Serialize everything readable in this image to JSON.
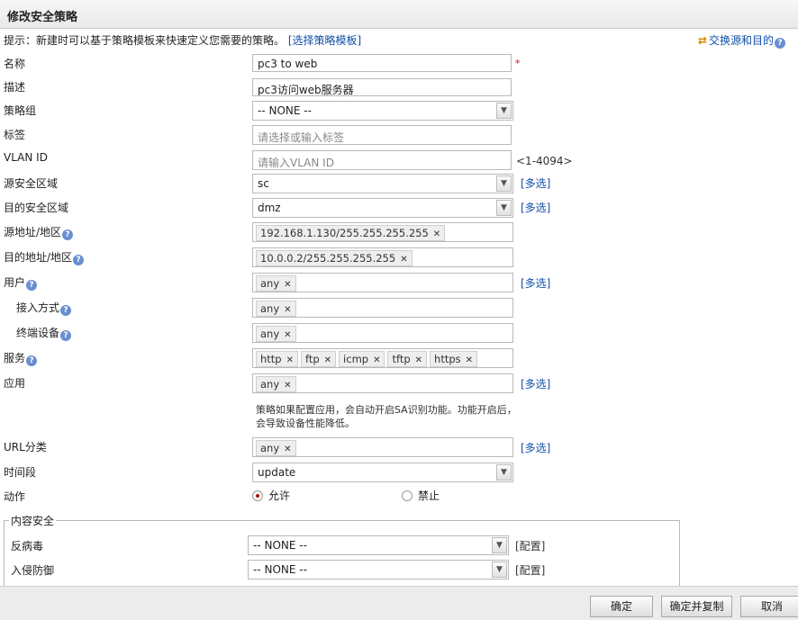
{
  "window": {
    "title": "修改安全策略"
  },
  "hint": {
    "prefix": "提示：新建时可以基于策略模板来快速定义您需要的策略。",
    "template_link": "[选择策略模板]"
  },
  "swap": {
    "label": "交换源和目的",
    "icon": "swap-arrows-icon"
  },
  "form": {
    "name": {
      "label": "名称",
      "value": "pc3 to web",
      "required": "*"
    },
    "desc": {
      "label": "描述",
      "value": "pc3访问web服务器"
    },
    "group": {
      "label": "策略组",
      "value": "-- NONE --"
    },
    "tag": {
      "label": "标签",
      "placeholder": "请选择或输入标签"
    },
    "vlan": {
      "label": "VLAN ID",
      "placeholder": "请输入VLAN ID",
      "range": "<1-4094>"
    },
    "src_zone": {
      "label": "源安全区域",
      "value": "sc",
      "more": "[多选]"
    },
    "dst_zone": {
      "label": "目的安全区域",
      "value": "dmz",
      "more": "[多选]"
    },
    "src_addr": {
      "label": "源地址/地区",
      "tags": [
        "192.168.1.130/255.255.255.255"
      ]
    },
    "dst_addr": {
      "label": "目的地址/地区",
      "tags": [
        "10.0.0.2/255.255.255.255"
      ]
    },
    "user": {
      "label": "用户",
      "tags": [
        "any"
      ],
      "more": "[多选]"
    },
    "access": {
      "label": "接入方式",
      "tags": [
        "any"
      ]
    },
    "terminal": {
      "label": "终端设备",
      "tags": [
        "any"
      ]
    },
    "service": {
      "label": "服务",
      "tags": [
        "http",
        "ftp",
        "icmp",
        "tftp",
        "https"
      ]
    },
    "app": {
      "label": "应用",
      "tags": [
        "any"
      ],
      "more": "[多选]",
      "note": "策略如果配置应用，会自动开启SA识别功能。功能开启后，会导致设备性能降低。"
    },
    "url": {
      "label": "URL分类",
      "tags": [
        "any"
      ],
      "more": "[多选]"
    },
    "time": {
      "label": "时间段",
      "value": "update"
    },
    "action": {
      "label": "动作",
      "allow": "允许",
      "deny": "禁止",
      "selected": "允许"
    }
  },
  "content_security": {
    "legend": "内容安全",
    "antivirus": {
      "label": "反病毒",
      "value": "-- NONE --",
      "config": "[配置]"
    },
    "ips": {
      "label": "入侵防御",
      "value": "-- NONE --",
      "config": "[配置]"
    }
  },
  "footer": {
    "ok": "确定",
    "ok_copy": "确定并复制",
    "cancel": "取消"
  },
  "colors": {
    "link": "#0f4fa8",
    "required": "#dd0000",
    "help_icon": "#6a8fd0"
  }
}
